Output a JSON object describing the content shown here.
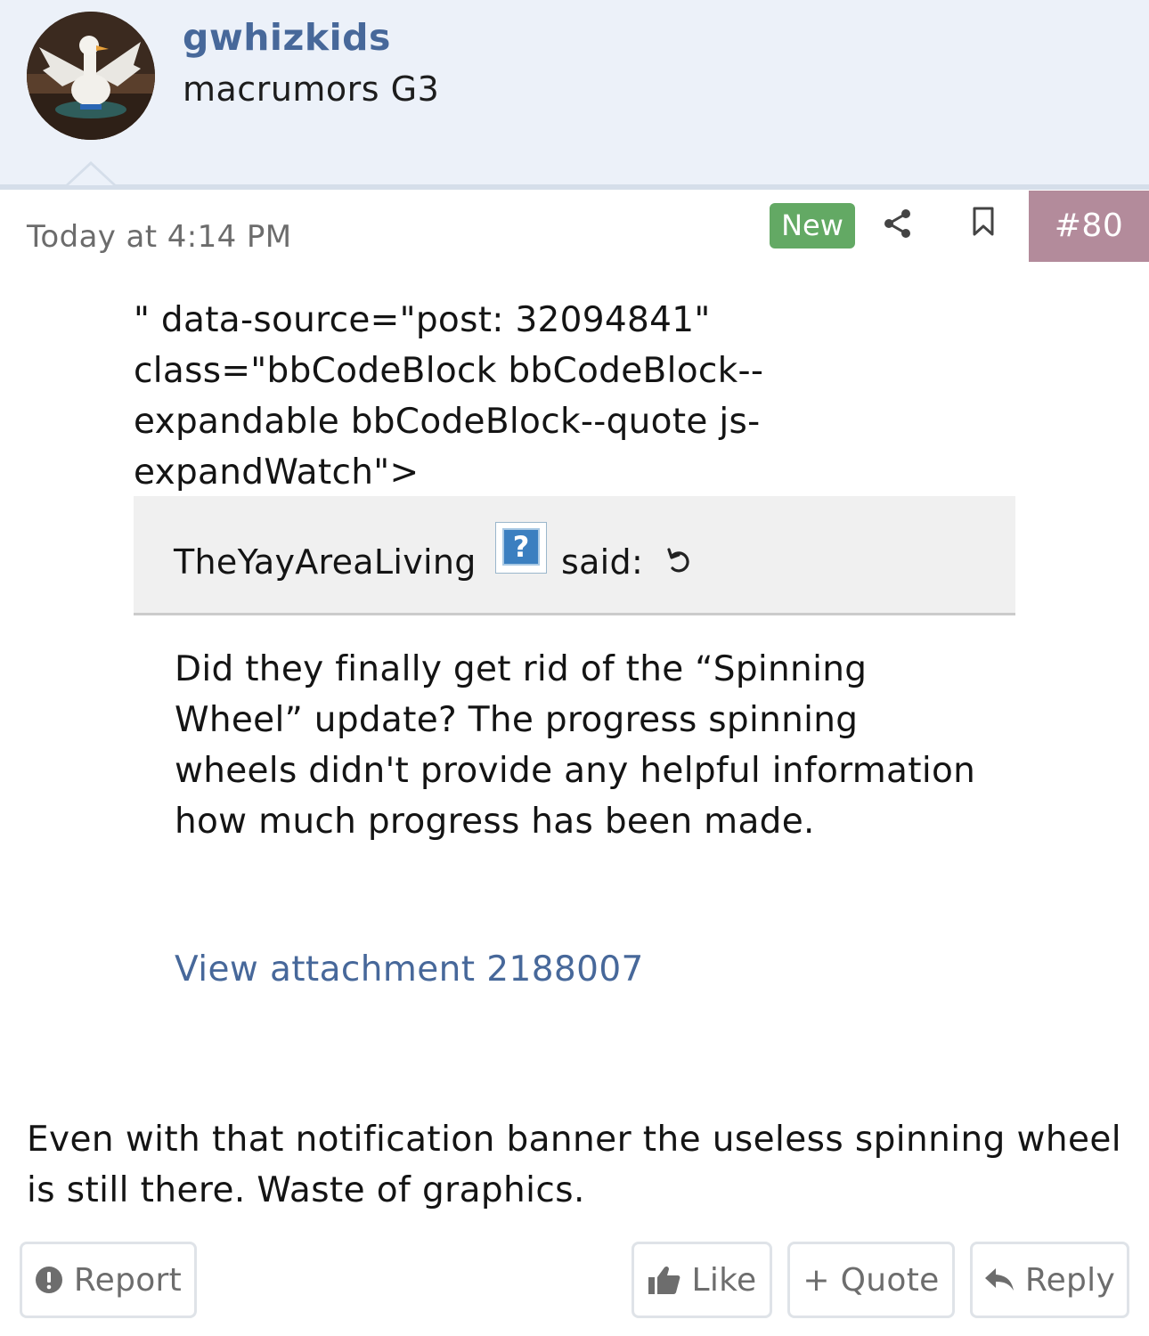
{
  "user": {
    "username": "gwhizkids",
    "title": "macrumors G3"
  },
  "post": {
    "date": "Today at 4:14 PM",
    "new_badge": "New",
    "number": "#80",
    "raw_lines": [
      "\" data-source=\"post: 32094841\"",
      "class=\"bbCodeBlock bbCodeBlock--",
      "expandable bbCodeBlock--quote js-",
      "expandWatch\">"
    ],
    "quote": {
      "author": "TheYayAreaLiving",
      "missing_image_glyph": "?",
      "said": "said:",
      "body": "Did they finally get rid of the “Spinning Wheel” update? The progress spinning wheels didn't provide any helpful information how much progress has been made.",
      "attachment_link": "View attachment 2188007"
    },
    "text": "Even with that notification banner the useless spinning wheel is still there. Waste of graphics."
  },
  "actions": {
    "report": "Report",
    "like": "Like",
    "quote": "+ Quote",
    "reply": "Reply"
  },
  "colors": {
    "header_bg": "#ecf1f9",
    "username": "#47689a",
    "new_badge": "#63a964",
    "post_number_bg": "#b38b9b",
    "link": "#47689a"
  },
  "icons": {
    "share": "share-icon",
    "bookmark": "bookmark-icon",
    "quote_jump": "undo-arrow-icon",
    "report": "exclamation-circle-icon",
    "like": "thumbs-up-icon",
    "reply": "reply-arrow-icon"
  }
}
